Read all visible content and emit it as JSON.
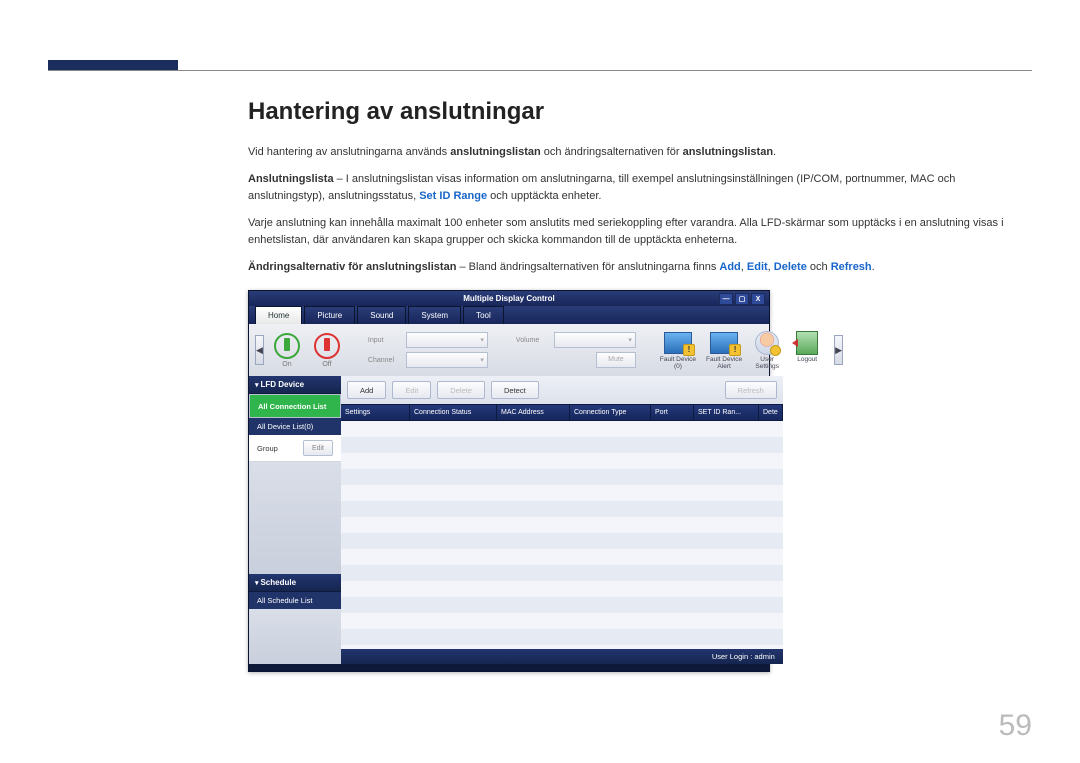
{
  "page": {
    "title": "Hantering av anslutningar",
    "number": "59",
    "para1_a": "Vid hantering av anslutningarna används ",
    "para1_b": "anslutningslistan",
    "para1_c": " och ändringsalternativen för ",
    "para1_d": "anslutningslistan",
    "para1_e": ".",
    "para2_a": "Anslutningslista",
    "para2_b": " – I anslutningslistan visas information om anslutningarna, till exempel anslutningsinställningen (IP/COM, portnummer, MAC och anslutningstyp), anslutningsstatus, ",
    "para2_c": "Set ID Range",
    "para2_d": " och upptäckta enheter.",
    "para3": "Varje anslutning kan innehålla maximalt 100 enheter som anslutits med seriekoppling efter varandra. Alla LFD-skärmar som upptäcks i en anslutning visas i enhetslistan, där användaren kan skapa grupper och skicka kommandon till de upptäckta enheterna.",
    "para4_a": "Ändringsalternativ för anslutningslistan",
    "para4_b": " – Bland ändringsalternativen för anslutningarna finns ",
    "para4_add": "Add",
    "para4_edit": "Edit",
    "para4_delete": "Delete",
    "para4_refresh": "Refresh",
    "para4_sep": ", ",
    "para4_och": " och ",
    "para4_end": "."
  },
  "app": {
    "title": "Multiple Display Control",
    "win": {
      "min": "—",
      "max": "▢",
      "close": "X"
    },
    "tabs": [
      "Home",
      "Picture",
      "Sound",
      "System",
      "Tool"
    ],
    "toolbar": {
      "on": "On",
      "off": "Off",
      "input_lbl": "Input",
      "channel_lbl": "Channel",
      "volume_lbl": "Volume",
      "mute_btn": "Mute",
      "fault_device": "Fault Device\n(0)",
      "fault_alert": "Fault Device\nAlert",
      "user_settings": "User Settings",
      "logout": "Logout"
    },
    "sidebar": {
      "lfd": "LFD Device",
      "all_conn": "All Connection List",
      "all_dev": "All Device List(0)",
      "group": "Group",
      "edit": "Edit",
      "schedule": "Schedule",
      "all_sched": "All Schedule List"
    },
    "buttons": {
      "add": "Add",
      "edit": "Edit",
      "delete": "Delete",
      "detect": "Detect",
      "refresh": "Refresh"
    },
    "columns": [
      "Settings",
      "Connection Status",
      "MAC Address",
      "Connection Type",
      "Port",
      "SET ID Ran...",
      "Dete"
    ],
    "footer": "User Login : admin"
  }
}
